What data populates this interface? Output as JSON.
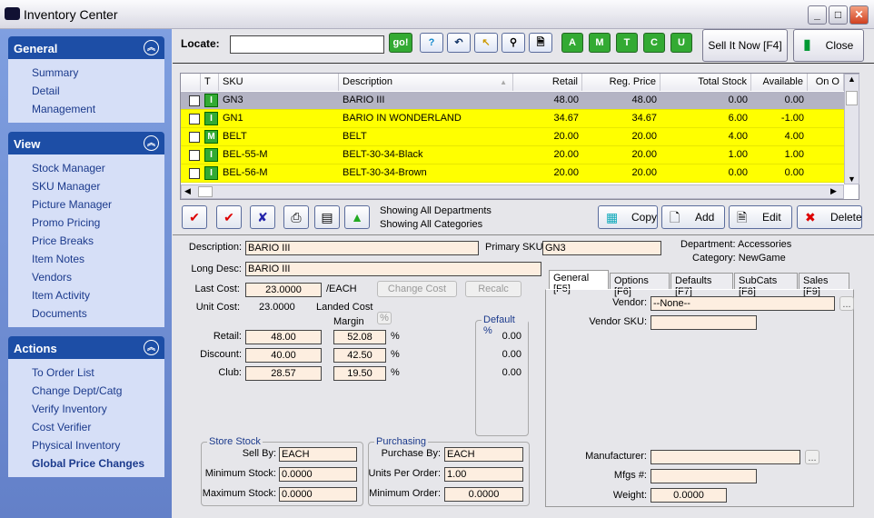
{
  "window": {
    "title": "Inventory Center"
  },
  "sidebar": {
    "general": {
      "title": "General",
      "items": [
        "Summary",
        "Detail",
        "Management"
      ]
    },
    "view": {
      "title": "View",
      "items": [
        "Stock Manager",
        "SKU Manager",
        "Picture Manager",
        "Promo Pricing",
        "Price Breaks",
        "Item Notes",
        "Vendors",
        "Item Activity",
        "Documents"
      ]
    },
    "actions": {
      "title": "Actions",
      "items": [
        "To Order List",
        "Change Dept/Catg",
        "Verify Inventory",
        "Cost Verifier",
        "Physical Inventory",
        "Global Price Changes"
      ]
    }
  },
  "toolbar": {
    "locate_label": "Locate:",
    "locate_value": "",
    "go": "go!",
    "letters": [
      "A",
      "M",
      "T",
      "C",
      "U"
    ],
    "sell_now": "Sell It Now [F4]",
    "close": "Close"
  },
  "grid": {
    "columns": [
      "T",
      "SKU",
      "Description",
      "Retail",
      "Reg. Price",
      "Total Stock",
      "Available",
      "On O"
    ],
    "rows": [
      {
        "t": "I",
        "sku": "GN3",
        "desc": "BARIO III",
        "retail": "48.00",
        "reg": "48.00",
        "total": "0.00",
        "avail": "0.00",
        "selected": true
      },
      {
        "t": "I",
        "sku": "GN1",
        "desc": "BARIO IN WONDERLAND",
        "retail": "34.67",
        "reg": "34.67",
        "total": "6.00",
        "avail": "-1.00"
      },
      {
        "t": "M",
        "sku": "BELT",
        "desc": "BELT",
        "retail": "20.00",
        "reg": "20.00",
        "total": "4.00",
        "avail": "4.00"
      },
      {
        "t": "I",
        "sku": "BEL-55-M",
        "desc": "BELT-30-34-Black",
        "retail": "20.00",
        "reg": "20.00",
        "total": "1.00",
        "avail": "1.00"
      },
      {
        "t": "I",
        "sku": "BEL-56-M",
        "desc": "BELT-30-34-Brown",
        "retail": "20.00",
        "reg": "20.00",
        "total": "0.00",
        "avail": "0.00"
      }
    ],
    "highlight_color": "#ffff00"
  },
  "actionbar": {
    "dept_status": "Showing All Departments",
    "cat_status": "Showing All Categories",
    "copy": "Copy",
    "add": "Add",
    "edit": "Edit",
    "delete": "Delete"
  },
  "detail": {
    "description_label": "Description:",
    "description": "BARIO III",
    "primary_sku_label": "Primary SKU:",
    "primary_sku": "GN3",
    "department": "Department: Accessories",
    "category": "Category: NewGame",
    "long_desc_label": "Long Desc:",
    "long_desc": "BARIO III",
    "last_cost_label": "Last Cost:",
    "last_cost": "23.0000",
    "per_unit": "/EACH",
    "change_cost": "Change Cost",
    "recalc": "Recalc",
    "unit_cost_label": "Unit Cost:",
    "unit_cost": "23.0000",
    "landed_cost": "Landed Cost",
    "margin_label": "Margin",
    "pct_button": "%",
    "default_pct": "Default %",
    "prices": [
      {
        "label": "Retail:",
        "price": "48.00",
        "margin": "52.08",
        "default": "0.00"
      },
      {
        "label": "Discount:",
        "price": "40.00",
        "margin": "42.50",
        "default": "0.00"
      },
      {
        "label": "Club:",
        "price": "28.57",
        "margin": "19.50",
        "default": "0.00"
      }
    ],
    "pct": "%",
    "store_stock": {
      "title": "Store Stock",
      "sell_by_label": "Sell By:",
      "sell_by": "EACH",
      "min_label": "Minimum Stock:",
      "min": "0.0000",
      "max_label": "Maximum Stock:",
      "max": "0.0000"
    },
    "purchasing": {
      "title": "Purchasing",
      "by_label": "Purchase By:",
      "by": "EACH",
      "units_label": "Units Per Order:",
      "units": "1.00",
      "min_label": "Minimum Order:",
      "min": "0.0000"
    },
    "tabs": [
      "General [F5]",
      "Options [F6]",
      "Defaults [F7]",
      "SubCats [F8]",
      "Sales [F9]"
    ],
    "vendor_label": "Vendor:",
    "vendor": "--None--",
    "vendor_sku_label": "Vendor SKU:",
    "vendor_sku": "",
    "manufacturer_label": "Manufacturer:",
    "manufacturer": "",
    "mfgs_label": "Mfgs #:",
    "mfgs": "",
    "weight_label": "Weight:",
    "weight": "0.0000",
    "ellipsis": "..."
  }
}
